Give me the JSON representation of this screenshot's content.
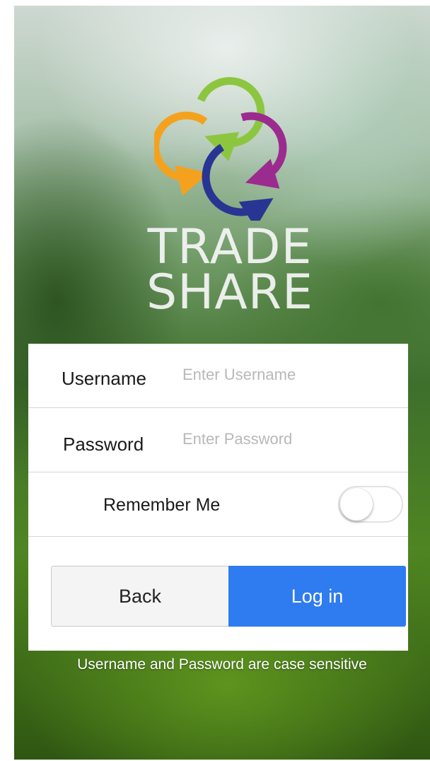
{
  "brand": {
    "line1": "TRADE",
    "line2": "SHARE",
    "logo_icon": "four-interlocking-circular-arrows-logo",
    "logo_colors": [
      "#8cc63f",
      "#f4a21e",
      "#9b2b8e",
      "#283593"
    ]
  },
  "form": {
    "username": {
      "label": "Username",
      "placeholder": "Enter Username",
      "value": ""
    },
    "password": {
      "label": "Password",
      "placeholder": "Enter Password",
      "value": ""
    },
    "remember": {
      "label": "Remember Me",
      "on": false
    }
  },
  "buttons": {
    "back": "Back",
    "login": "Log in"
  },
  "colors": {
    "accent": "#2f7bf0"
  },
  "note": "Username and Password are case sensitive"
}
